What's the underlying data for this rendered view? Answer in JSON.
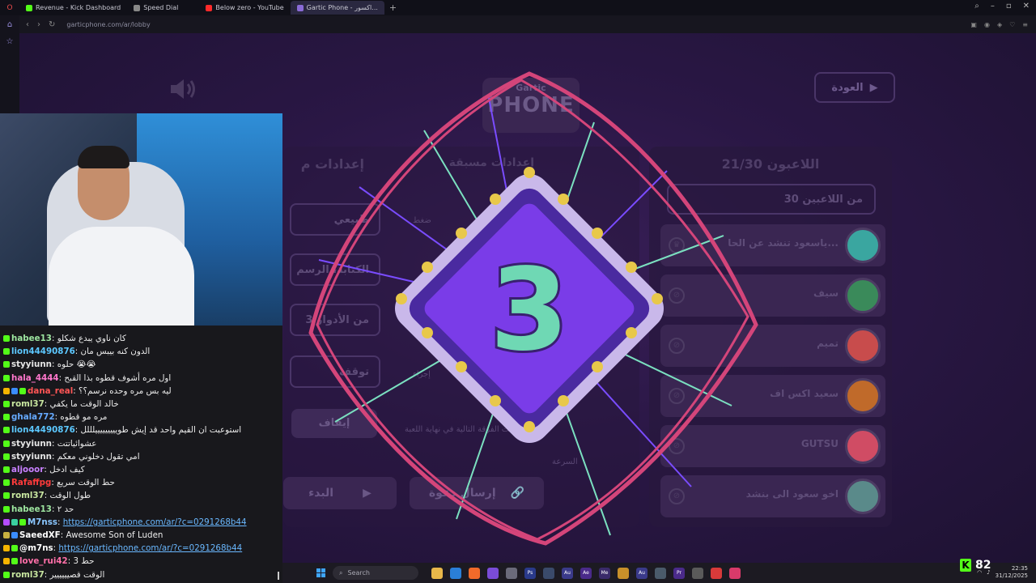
{
  "browser": {
    "tabs": [
      {
        "label": "Revenue - Kick Dashboard",
        "color": "#53fc18"
      },
      {
        "label": "Speed Dial",
        "color": "#888888"
      },
      {
        "label": "Below zero - YouTube",
        "color": "#ff2a2a"
      },
      {
        "label": "Gartic Phone - اكسور...",
        "color": "#8a6bd6"
      }
    ],
    "url": "garticphone.com/ar/lobby"
  },
  "game": {
    "logo_top": "Gartic",
    "logo_bottom": "PHONE",
    "back_label": "العودة",
    "players_title": "اللاعبون 21/30",
    "players_filter": "30 من اللاعبين",
    "players": [
      {
        "name": "ياسعود تنشد عن الحا...",
        "badge": "♛",
        "color": "#3aa6a0"
      },
      {
        "name": "سيف",
        "badge": "⊘",
        "color": "#3a8a5a"
      },
      {
        "name": "تميم",
        "badge": "⊘",
        "color": "#c84c4c"
      },
      {
        "name": "سعيد اكس اف",
        "badge": "⊘",
        "color": "#c06a2a"
      },
      {
        "name": "GUTSU",
        "badge": "⊘",
        "color": "#d04c64"
      },
      {
        "name": "اخو سعود الى بنشد",
        "badge": "⊘",
        "color": "#5a8a8a"
      }
    ],
    "settings_title": "إعدادات م",
    "settings_title2": "إعدادات مسبقة",
    "settings": [
      {
        "label": "طبيعي"
      },
      {
        "label": "الكتابة، الرسم"
      },
      {
        "label": "3 من الأدوار"
      },
      {
        "label": "توقف"
      }
    ],
    "setting_notes": [
      "ضغط",
      "إجراء",
      "ما إذا قامت الفرقة التالية في نهاية اللعبة",
      "السرعة"
    ],
    "stop_label": "إيقاف",
    "start_label": "البدء",
    "invite_label": "إرسال دعوة",
    "countdown": "3"
  },
  "chat": {
    "messages": [
      {
        "user": "habee13",
        "color": "#9ee6a0",
        "text": "كان ناوي يبدع شكلو"
      },
      {
        "user": "lion44490876",
        "color": "#5cc8ff",
        "text": "الدون كنه بيبس مان"
      },
      {
        "user": "styyiunn",
        "color": "#e6e6e6",
        "text": "حلوه 😭😭"
      },
      {
        "user": "hala_4444",
        "color": "#ff77cc",
        "text": "اول مره أشوف قطوه بذا القبح"
      },
      {
        "user": "dana_real",
        "color": "#ff5555",
        "text": "ليه بس مره وحده نرسم؟؟"
      },
      {
        "user": "roml37",
        "color": "#c8e6a0",
        "text": "خالد الوقت ما يكفي"
      },
      {
        "user": "ghala772",
        "color": "#66aaff",
        "text": "مره مو قطوه"
      },
      {
        "user": "lion44490876",
        "color": "#5cc8ff",
        "text": "استوعبت ان القيم واحد قد إيش طويييييييييلللل"
      },
      {
        "user": "styyiunn",
        "color": "#e6e6e6",
        "text": "عشوائياتتت"
      },
      {
        "user": "styyiunn",
        "color": "#e6e6e6",
        "text": "امي تقول دخلوني معكم"
      },
      {
        "user": "aljooor",
        "color": "#c880ff",
        "text": "كيف ادخل"
      },
      {
        "user": "Rafaffpg",
        "color": "#ff3b3b",
        "text": "حط الوقت سريع"
      },
      {
        "user": "roml37",
        "color": "#c8e6a0",
        "text": "طول الوقت"
      },
      {
        "user": "habee13",
        "color": "#9ee6a0",
        "text": "حد ٢"
      },
      {
        "user": "M7nss",
        "color": "#8ac6ff",
        "link": "https://garticphone.com/ar/?c=0291268b44"
      },
      {
        "user": "SaeedXF",
        "color": "#ffffff",
        "text": "Awesome Son of Luden"
      },
      {
        "user": "@m7ns",
        "color": "#ffffff",
        "link": "https://garticphone.com/ar/?c=0291268b44"
      },
      {
        "user": "love_rui42",
        "color": "#ff6fa8",
        "text": "3 حط"
      },
      {
        "user": "roml37",
        "color": "#c8e6a0",
        "text": "الوقت قصيييييير"
      }
    ]
  },
  "taskbar": {
    "search_placeholder": "Search",
    "time": "22:35",
    "date": "31/12/2025"
  },
  "kick": {
    "viewers": "82"
  }
}
